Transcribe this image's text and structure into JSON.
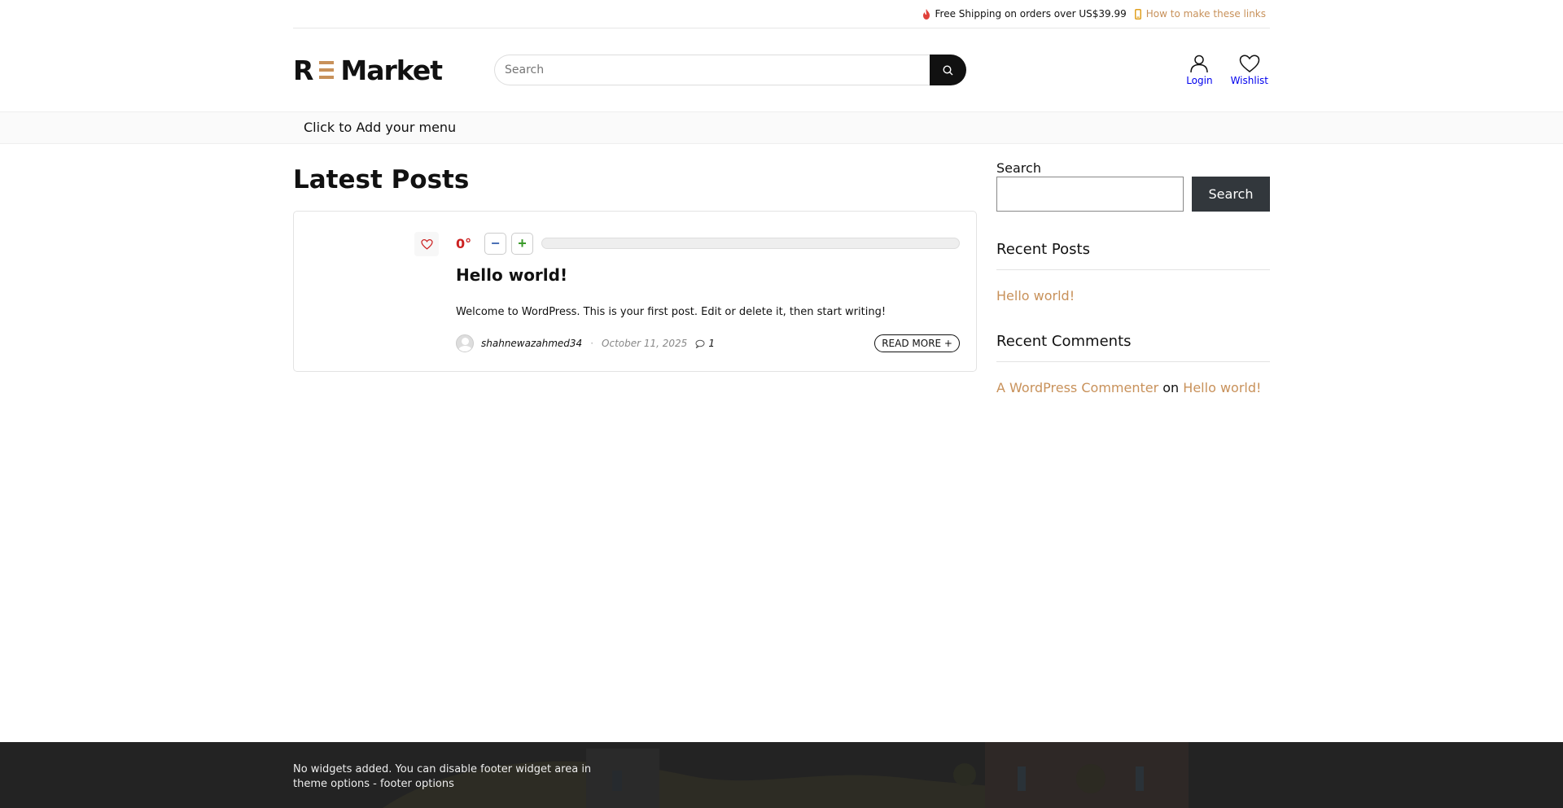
{
  "topbar": {
    "shipping_text": "Free Shipping on orders over US$39.99",
    "howto_link": "How to make these links"
  },
  "header": {
    "logo_left": "R",
    "logo_right": "Market",
    "search_placeholder": "Search",
    "login_label": "Login",
    "wishlist_label": "Wishlist"
  },
  "menu": {
    "placeholder": "Click to Add your menu"
  },
  "main": {
    "page_title": "Latest Posts",
    "posts": [
      {
        "vote_value": "0",
        "vote_unit": "°",
        "vote_level": 0,
        "minus_label": "−",
        "plus_label": "+",
        "title": "Hello world!",
        "excerpt": "Welcome to WordPress. This is your first post. Edit or delete it, then start writing!",
        "author": "shahnewazahmed34",
        "separator": "·",
        "date": "October 11, 2025",
        "comment_count": "1",
        "read_more": "READ MORE +"
      }
    ]
  },
  "sidebar": {
    "search_label": "Search",
    "search_button": "Search",
    "recent_posts_title": "Recent Posts",
    "recent_posts": [
      "Hello world!"
    ],
    "recent_comments_title": "Recent Comments",
    "recent_comment": {
      "author": "A WordPress Commenter",
      "on": "on",
      "post": "Hello world!"
    }
  },
  "footer": {
    "notice": "No widgets added. You can disable footer widget area in theme options - footer options"
  },
  "colors": {
    "accent": "#c8915a",
    "vote_red": "#cc2222",
    "footer_bg": "#222222",
    "sidebar_button": "#32373c"
  }
}
